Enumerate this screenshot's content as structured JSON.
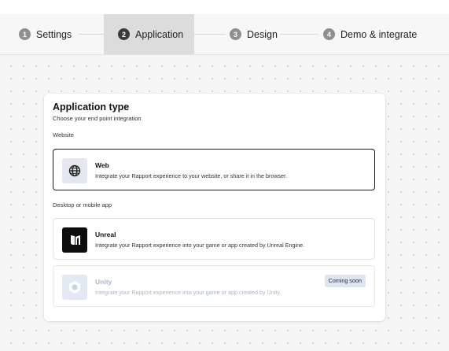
{
  "stepper": {
    "steps": [
      {
        "number": "1",
        "label": "Settings",
        "state": "inactive"
      },
      {
        "number": "2",
        "label": "Application",
        "state": "active"
      },
      {
        "number": "3",
        "label": "Design",
        "state": "inactive"
      },
      {
        "number": "4",
        "label": "Demo & integrate",
        "state": "inactive"
      }
    ]
  },
  "card": {
    "title": "Application type",
    "subtitle": "Choose your end point integration",
    "sections": [
      {
        "label": "Website",
        "options": [
          {
            "title": "Web",
            "description": "Integrate your Rapport experience to your website, or share it in the browser.",
            "icon": "globe-icon",
            "state": "selected"
          }
        ]
      },
      {
        "label": "Desktop or mobile app",
        "options": [
          {
            "title": "Unreal",
            "description": "Integrate your Rapport experience into your game or app created by Unreal Engine.",
            "icon": "unreal-logo-icon",
            "state": "default"
          },
          {
            "title": "Unity",
            "description": "Integrate your Rapport experience into your game or app created by Unity.",
            "icon": "unity-logo-icon",
            "state": "disabled",
            "badge": "Coming soon"
          }
        ]
      }
    ]
  },
  "colors": {
    "active_step_bg": "#dcdcdc",
    "selected_border": "#1a1a1a",
    "disabled_text": "#a9b3c8",
    "badge_bg": "#dfe4ee"
  }
}
